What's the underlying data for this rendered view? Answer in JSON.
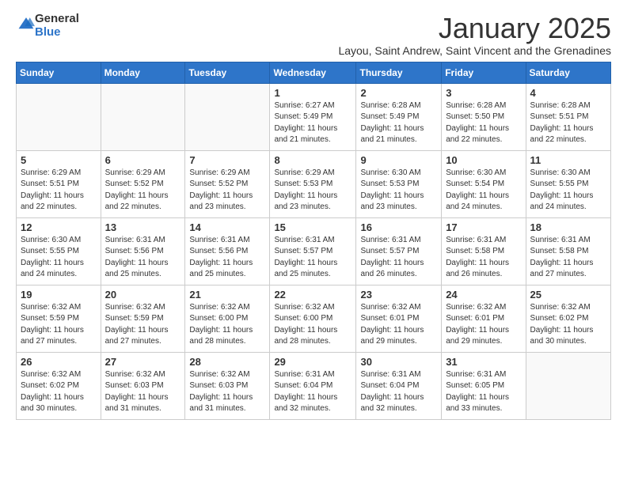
{
  "logo": {
    "text_general": "General",
    "text_blue": "Blue"
  },
  "header": {
    "month": "January 2025",
    "location": "Layou, Saint Andrew, Saint Vincent and the Grenadines"
  },
  "weekdays": [
    "Sunday",
    "Monday",
    "Tuesday",
    "Wednesday",
    "Thursday",
    "Friday",
    "Saturday"
  ],
  "weeks": [
    [
      {
        "day": "",
        "sunrise": "",
        "sunset": "",
        "daylight": "",
        "empty": true
      },
      {
        "day": "",
        "sunrise": "",
        "sunset": "",
        "daylight": "",
        "empty": true
      },
      {
        "day": "",
        "sunrise": "",
        "sunset": "",
        "daylight": "",
        "empty": true
      },
      {
        "day": "1",
        "sunrise": "Sunrise: 6:27 AM",
        "sunset": "Sunset: 5:49 PM",
        "daylight": "Daylight: 11 hours and 21 minutes."
      },
      {
        "day": "2",
        "sunrise": "Sunrise: 6:28 AM",
        "sunset": "Sunset: 5:49 PM",
        "daylight": "Daylight: 11 hours and 21 minutes."
      },
      {
        "day": "3",
        "sunrise": "Sunrise: 6:28 AM",
        "sunset": "Sunset: 5:50 PM",
        "daylight": "Daylight: 11 hours and 22 minutes."
      },
      {
        "day": "4",
        "sunrise": "Sunrise: 6:28 AM",
        "sunset": "Sunset: 5:51 PM",
        "daylight": "Daylight: 11 hours and 22 minutes."
      }
    ],
    [
      {
        "day": "5",
        "sunrise": "Sunrise: 6:29 AM",
        "sunset": "Sunset: 5:51 PM",
        "daylight": "Daylight: 11 hours and 22 minutes."
      },
      {
        "day": "6",
        "sunrise": "Sunrise: 6:29 AM",
        "sunset": "Sunset: 5:52 PM",
        "daylight": "Daylight: 11 hours and 22 minutes."
      },
      {
        "day": "7",
        "sunrise": "Sunrise: 6:29 AM",
        "sunset": "Sunset: 5:52 PM",
        "daylight": "Daylight: 11 hours and 23 minutes."
      },
      {
        "day": "8",
        "sunrise": "Sunrise: 6:29 AM",
        "sunset": "Sunset: 5:53 PM",
        "daylight": "Daylight: 11 hours and 23 minutes."
      },
      {
        "day": "9",
        "sunrise": "Sunrise: 6:30 AM",
        "sunset": "Sunset: 5:53 PM",
        "daylight": "Daylight: 11 hours and 23 minutes."
      },
      {
        "day": "10",
        "sunrise": "Sunrise: 6:30 AM",
        "sunset": "Sunset: 5:54 PM",
        "daylight": "Daylight: 11 hours and 24 minutes."
      },
      {
        "day": "11",
        "sunrise": "Sunrise: 6:30 AM",
        "sunset": "Sunset: 5:55 PM",
        "daylight": "Daylight: 11 hours and 24 minutes."
      }
    ],
    [
      {
        "day": "12",
        "sunrise": "Sunrise: 6:30 AM",
        "sunset": "Sunset: 5:55 PM",
        "daylight": "Daylight: 11 hours and 24 minutes."
      },
      {
        "day": "13",
        "sunrise": "Sunrise: 6:31 AM",
        "sunset": "Sunset: 5:56 PM",
        "daylight": "Daylight: 11 hours and 25 minutes."
      },
      {
        "day": "14",
        "sunrise": "Sunrise: 6:31 AM",
        "sunset": "Sunset: 5:56 PM",
        "daylight": "Daylight: 11 hours and 25 minutes."
      },
      {
        "day": "15",
        "sunrise": "Sunrise: 6:31 AM",
        "sunset": "Sunset: 5:57 PM",
        "daylight": "Daylight: 11 hours and 25 minutes."
      },
      {
        "day": "16",
        "sunrise": "Sunrise: 6:31 AM",
        "sunset": "Sunset: 5:57 PM",
        "daylight": "Daylight: 11 hours and 26 minutes."
      },
      {
        "day": "17",
        "sunrise": "Sunrise: 6:31 AM",
        "sunset": "Sunset: 5:58 PM",
        "daylight": "Daylight: 11 hours and 26 minutes."
      },
      {
        "day": "18",
        "sunrise": "Sunrise: 6:31 AM",
        "sunset": "Sunset: 5:58 PM",
        "daylight": "Daylight: 11 hours and 27 minutes."
      }
    ],
    [
      {
        "day": "19",
        "sunrise": "Sunrise: 6:32 AM",
        "sunset": "Sunset: 5:59 PM",
        "daylight": "Daylight: 11 hours and 27 minutes."
      },
      {
        "day": "20",
        "sunrise": "Sunrise: 6:32 AM",
        "sunset": "Sunset: 5:59 PM",
        "daylight": "Daylight: 11 hours and 27 minutes."
      },
      {
        "day": "21",
        "sunrise": "Sunrise: 6:32 AM",
        "sunset": "Sunset: 6:00 PM",
        "daylight": "Daylight: 11 hours and 28 minutes."
      },
      {
        "day": "22",
        "sunrise": "Sunrise: 6:32 AM",
        "sunset": "Sunset: 6:00 PM",
        "daylight": "Daylight: 11 hours and 28 minutes."
      },
      {
        "day": "23",
        "sunrise": "Sunrise: 6:32 AM",
        "sunset": "Sunset: 6:01 PM",
        "daylight": "Daylight: 11 hours and 29 minutes."
      },
      {
        "day": "24",
        "sunrise": "Sunrise: 6:32 AM",
        "sunset": "Sunset: 6:01 PM",
        "daylight": "Daylight: 11 hours and 29 minutes."
      },
      {
        "day": "25",
        "sunrise": "Sunrise: 6:32 AM",
        "sunset": "Sunset: 6:02 PM",
        "daylight": "Daylight: 11 hours and 30 minutes."
      }
    ],
    [
      {
        "day": "26",
        "sunrise": "Sunrise: 6:32 AM",
        "sunset": "Sunset: 6:02 PM",
        "daylight": "Daylight: 11 hours and 30 minutes."
      },
      {
        "day": "27",
        "sunrise": "Sunrise: 6:32 AM",
        "sunset": "Sunset: 6:03 PM",
        "daylight": "Daylight: 11 hours and 31 minutes."
      },
      {
        "day": "28",
        "sunrise": "Sunrise: 6:32 AM",
        "sunset": "Sunset: 6:03 PM",
        "daylight": "Daylight: 11 hours and 31 minutes."
      },
      {
        "day": "29",
        "sunrise": "Sunrise: 6:31 AM",
        "sunset": "Sunset: 6:04 PM",
        "daylight": "Daylight: 11 hours and 32 minutes."
      },
      {
        "day": "30",
        "sunrise": "Sunrise: 6:31 AM",
        "sunset": "Sunset: 6:04 PM",
        "daylight": "Daylight: 11 hours and 32 minutes."
      },
      {
        "day": "31",
        "sunrise": "Sunrise: 6:31 AM",
        "sunset": "Sunset: 6:05 PM",
        "daylight": "Daylight: 11 hours and 33 minutes."
      },
      {
        "day": "",
        "sunrise": "",
        "sunset": "",
        "daylight": "",
        "empty": true
      }
    ]
  ]
}
